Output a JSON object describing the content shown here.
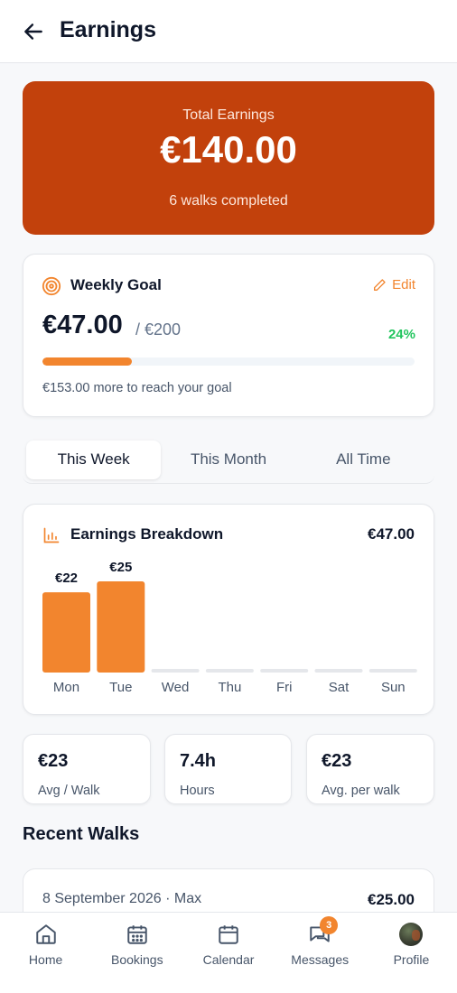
{
  "header": {
    "title": "Earnings"
  },
  "total": {
    "label": "Total Earnings",
    "amount": "€140.00",
    "subtitle": "6 walks completed"
  },
  "goal": {
    "title": "Weekly Goal",
    "edit_label": "Edit",
    "current": "€47.00",
    "target": "/ €200",
    "percent": "24%",
    "progress_fraction": 0.24,
    "remaining": "€153.00 more to reach your goal"
  },
  "tabs": [
    {
      "label": "This Week",
      "active": true
    },
    {
      "label": "This Month",
      "active": false
    },
    {
      "label": "All Time",
      "active": false
    }
  ],
  "breakdown": {
    "title": "Earnings Breakdown",
    "total": "€47.00"
  },
  "chart_data": {
    "type": "bar",
    "categories": [
      "Mon",
      "Tue",
      "Wed",
      "Thu",
      "Fri",
      "Sat",
      "Sun"
    ],
    "values": [
      22,
      25,
      0,
      0,
      0,
      0,
      0
    ],
    "value_labels": [
      "€22",
      "€25",
      "",
      "",
      "",
      "",
      ""
    ],
    "ylim": [
      0,
      25
    ]
  },
  "stats": [
    {
      "value": "€23",
      "label": "Avg / Walk"
    },
    {
      "value": "7.4h",
      "label": "Hours"
    },
    {
      "value": "€23",
      "label": "Avg. per walk"
    }
  ],
  "recent": {
    "title": "Recent Walks",
    "walks": [
      {
        "meta": "8 September 2026 · Max",
        "amount": "€25.00"
      }
    ]
  },
  "nav": {
    "items": [
      {
        "label": "Home",
        "icon": "home-icon"
      },
      {
        "label": "Bookings",
        "icon": "calendar-grid-icon"
      },
      {
        "label": "Calendar",
        "icon": "calendar-icon"
      },
      {
        "label": "Messages",
        "icon": "chat-icon",
        "badge": "3"
      },
      {
        "label": "Profile",
        "icon": "avatar"
      }
    ]
  },
  "colors": {
    "brand": "#c2410c",
    "accent": "#f2852e",
    "success": "#22c55e"
  }
}
